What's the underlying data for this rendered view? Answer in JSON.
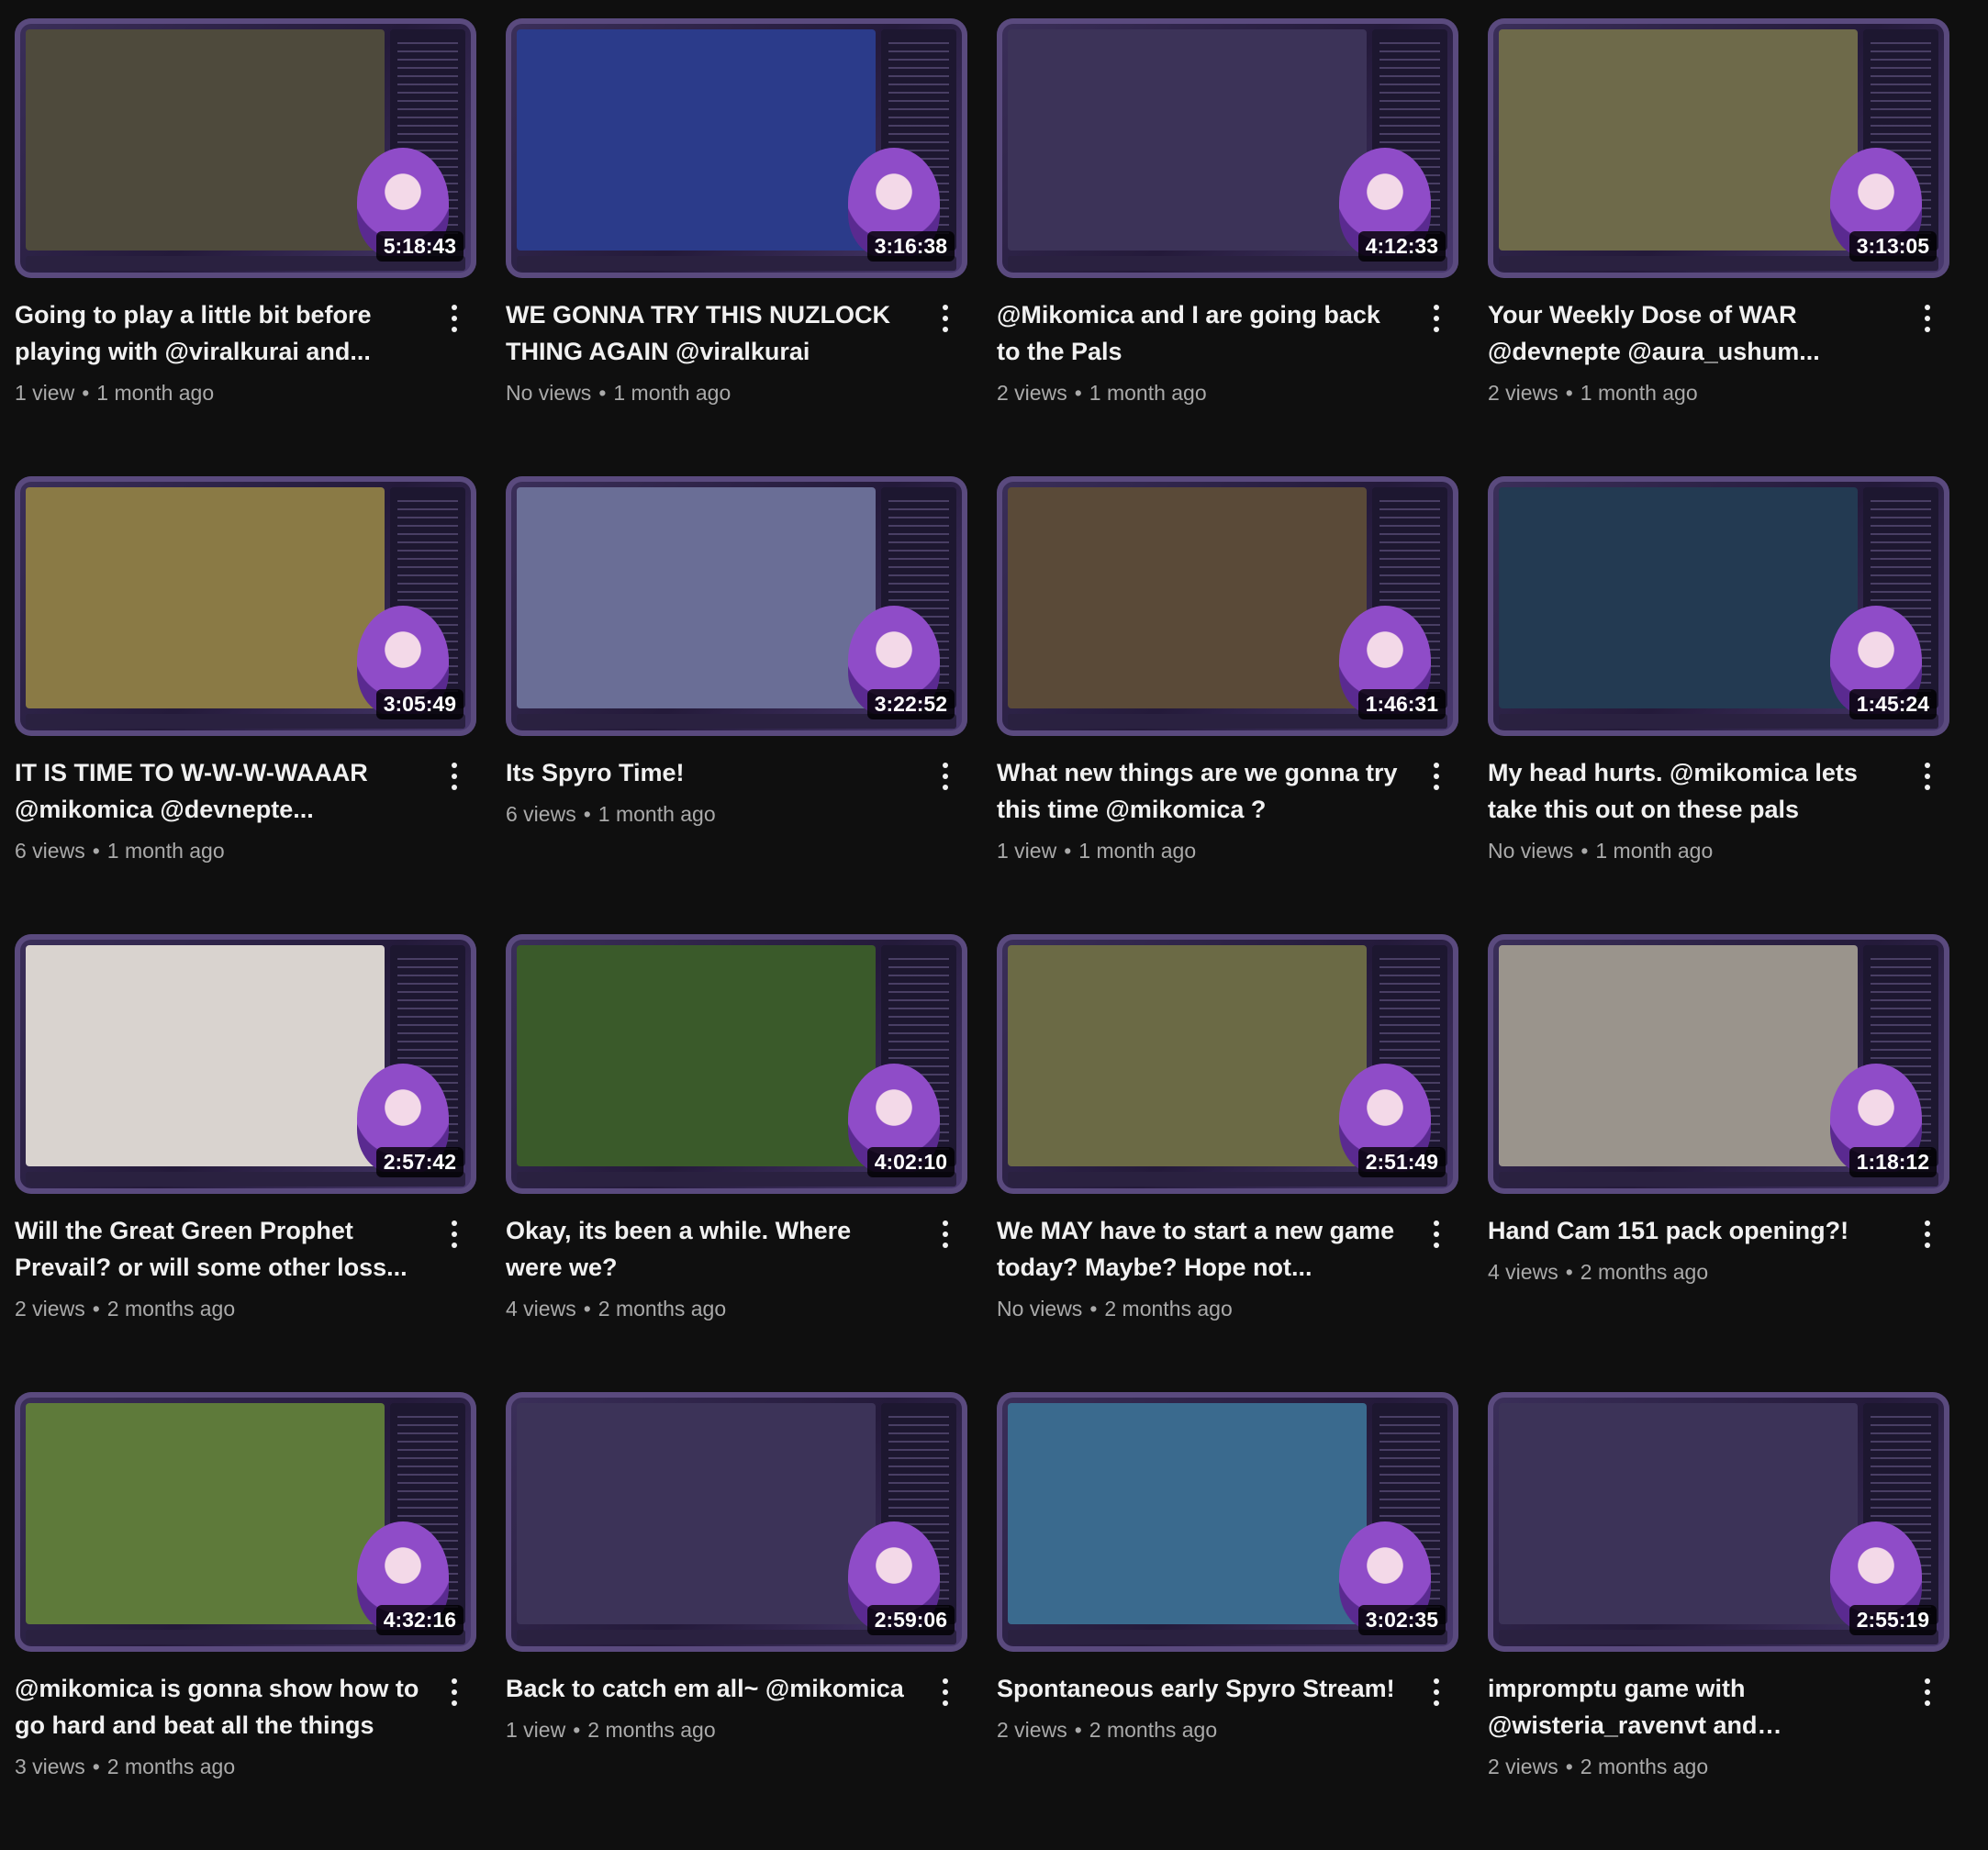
{
  "videos": [
    {
      "title": "Going to play a little bit before playing with @viralkurai and...",
      "views": "1 view",
      "age": "1 month ago",
      "duration": "5:18:43",
      "scene": "#4e4a3c"
    },
    {
      "title": "WE GONNA TRY THIS NUZLOCK THING AGAIN @viralkurai",
      "views": "No views",
      "age": "1 month ago",
      "duration": "3:16:38",
      "scene": "#2b3b8a"
    },
    {
      "title": "@Mikomica and I are going back to the Pals",
      "views": "2 views",
      "age": "1 month ago",
      "duration": "4:12:33",
      "scene": "#3c3358"
    },
    {
      "title": "Your Weekly Dose of WAR @devnepte @aura_ushum...",
      "views": "2 views",
      "age": "1 month ago",
      "duration": "3:13:05",
      "scene": "#6e6a4a"
    },
    {
      "title": "IT IS TIME TO W-W-W-WAAAR @mikomica @devnepte...",
      "views": "6 views",
      "age": "1 month ago",
      "duration": "3:05:49",
      "scene": "#8a7a45"
    },
    {
      "title": "Its Spyro Time!",
      "views": "6 views",
      "age": "1 month ago",
      "duration": "3:22:52",
      "scene": "#6a6e96"
    },
    {
      "title": "What new things are we gonna try this time @mikomica ?",
      "views": "1 view",
      "age": "1 month ago",
      "duration": "1:46:31",
      "scene": "#5a4a38"
    },
    {
      "title": "My head hurts. @mikomica lets take this out on these pals",
      "views": "No views",
      "age": "1 month ago",
      "duration": "1:45:24",
      "scene": "#233a52"
    },
    {
      "title": "Will the Great Green Prophet Prevail? or will some other loss...",
      "views": "2 views",
      "age": "2 months ago",
      "duration": "2:57:42",
      "scene": "#d9d3cf"
    },
    {
      "title": "Okay, its been a while. Where were we?",
      "views": "4 views",
      "age": "2 months ago",
      "duration": "4:02:10",
      "scene": "#3a5a2a"
    },
    {
      "title": "We MAY have to start a new game today? Maybe? Hope not...",
      "views": "No views",
      "age": "2 months ago",
      "duration": "2:51:49",
      "scene": "#6b6a45"
    },
    {
      "title": "Hand Cam 151 pack opening?!",
      "views": "4 views",
      "age": "2 months ago",
      "duration": "1:18:12",
      "scene": "#9a948c"
    },
    {
      "title": "@mikomica is gonna show how to go hard and beat all the things",
      "views": "3 views",
      "age": "2 months ago",
      "duration": "4:32:16",
      "scene": "#5e7a3a"
    },
    {
      "title": "Back to catch em all~ @mikomica",
      "views": "1 view",
      "age": "2 months ago",
      "duration": "2:59:06",
      "scene": "#3c3358"
    },
    {
      "title": "Spontaneous early Spyro Stream!",
      "views": "2 views",
      "age": "2 months ago",
      "duration": "3:02:35",
      "scene": "#3a6a8e"
    },
    {
      "title": "impromptu game with @wisteria_ravenvt and @viralkurai",
      "views": "2 views",
      "age": "2 months ago",
      "duration": "2:55:19",
      "scene": "#3c3358"
    }
  ],
  "icons": {
    "menu": "more-vert-icon"
  },
  "separator": "•"
}
